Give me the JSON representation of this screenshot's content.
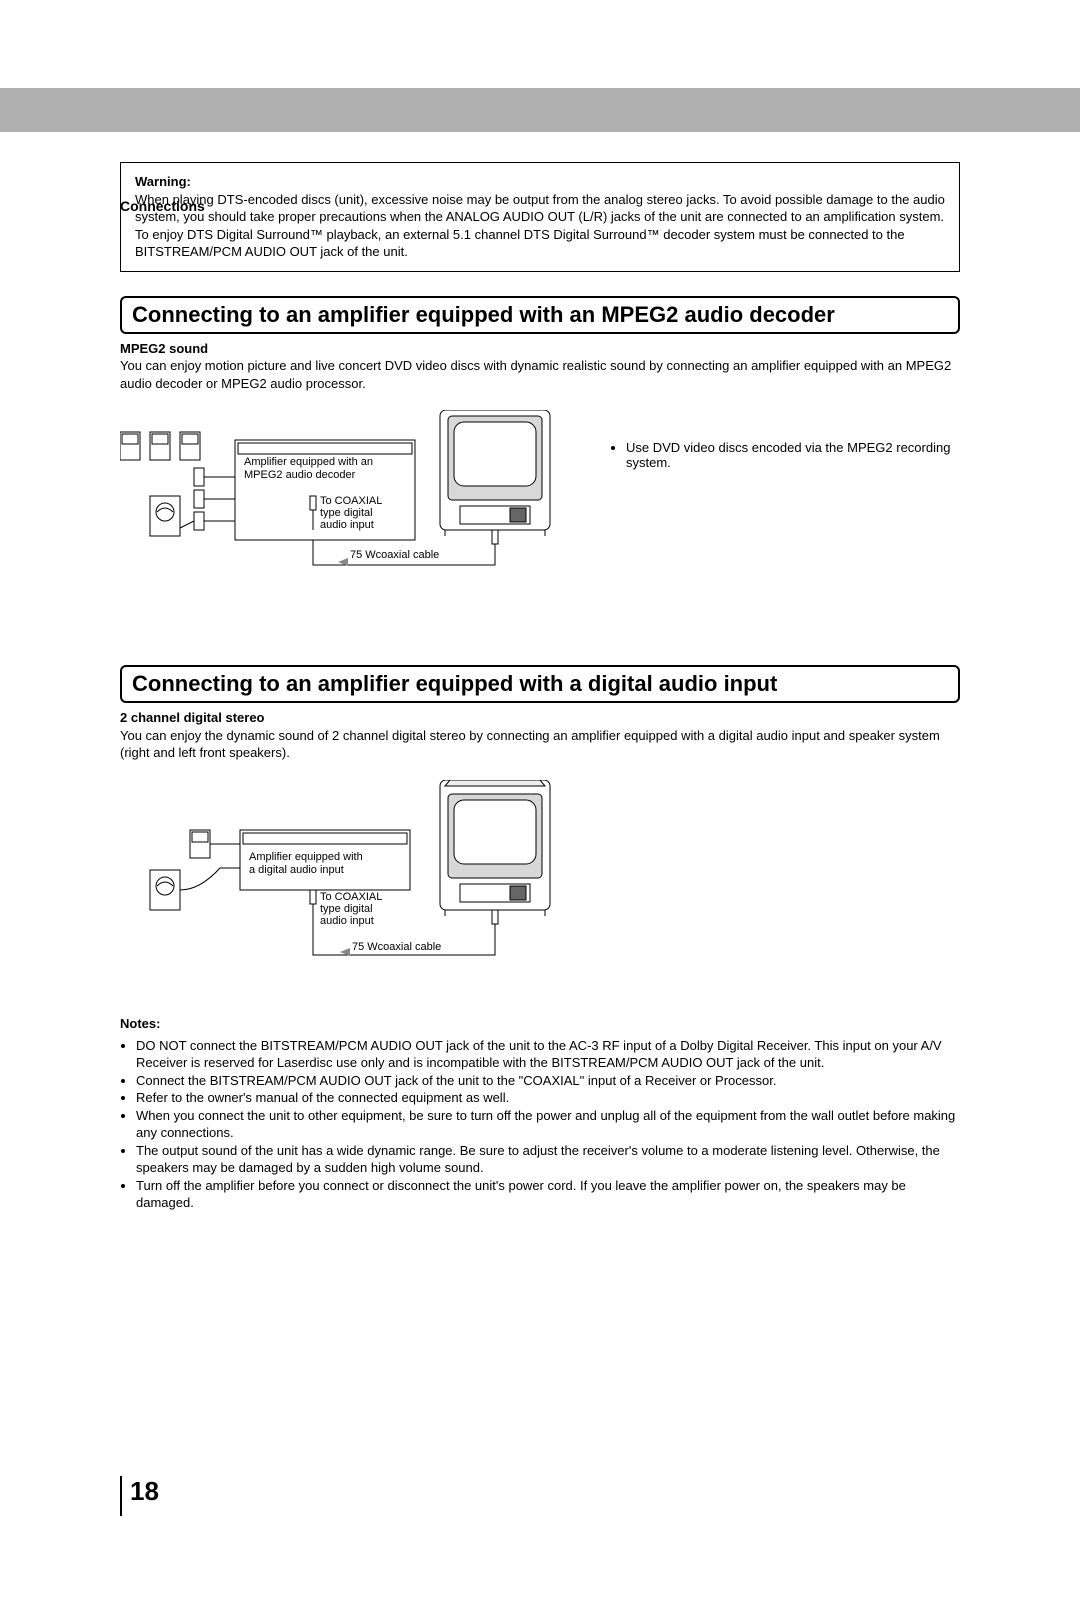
{
  "header": {
    "section": "Connections"
  },
  "warning": {
    "label": "Warning:",
    "text": "When playing DTS-encoded discs (unit), excessive noise may be output from the analog stereo jacks.  To avoid possible damage to the audio system, you should take proper precautions when the ANALOG AUDIO OUT (L/R) jacks of the unit are connected to an amplification system.  To enjoy DTS Digital Surround™ playback, an external 5.1 channel DTS Digital Surround™ decoder system must be connected to the BITSTREAM/PCM AUDIO OUT jack of the unit."
  },
  "section1": {
    "title": "Connecting to an amplifier equipped with an MPEG2 audio decoder",
    "sub_label": "MPEG2 sound",
    "text": "You can enjoy motion picture and live concert DVD video discs with dynamic realistic sound by connecting an amplifier equipped with an MPEG2 audio decoder or MPEG2 audio processor.",
    "diagram": {
      "amp_label_1": "Amplifier equipped with an",
      "amp_label_2": "MPEG2 audio decoder",
      "coax_1": "To COAXIAL",
      "coax_2": "type digital",
      "coax_3": "audio input",
      "cable": "75 Wcoaxial cable"
    },
    "side_note": "Use DVD video discs encoded via the MPEG2 recording system."
  },
  "section2": {
    "title": "Connecting to an amplifier equipped with a digital audio input",
    "sub_label": "2 channel digital stereo",
    "text": "You can enjoy the dynamic sound of 2 channel digital stereo by connecting an amplifier equipped with a digital audio input and speaker system (right and left front speakers).",
    "diagram": {
      "amp_label_1": "Amplifier equipped with",
      "amp_label_2": "a digital audio input",
      "coax_1": "To COAXIAL",
      "coax_2": "type digital",
      "coax_3": "audio input",
      "cable": "75 Wcoaxial cable"
    }
  },
  "notes": {
    "label": "Notes:",
    "items": [
      "DO NOT connect the BITSTREAM/PCM AUDIO OUT jack of the unit to the AC-3 RF input of a Dolby Digital Receiver.  This input on your A/V Receiver is reserved for Laserdisc use only and is incompatible with the BITSTREAM/PCM AUDIO OUT jack of the unit.",
      "Connect the BITSTREAM/PCM AUDIO OUT jack of the unit to the \"COAXIAL\" input of a Receiver or Processor.",
      "Refer to the owner's manual of the connected equipment as well.",
      "When you connect the unit to other equipment, be sure to turn off the power and unplug all of the equipment from the wall outlet before making any connections.",
      "The output sound of the unit has a wide dynamic range. Be sure to adjust the receiver's volume to a moderate listening level. Otherwise, the speakers may be damaged by a sudden high volume sound.",
      "Turn off the amplifier before you connect or disconnect the unit's power cord. If you leave the amplifier power on, the speakers may be damaged."
    ]
  },
  "page_number": "18"
}
